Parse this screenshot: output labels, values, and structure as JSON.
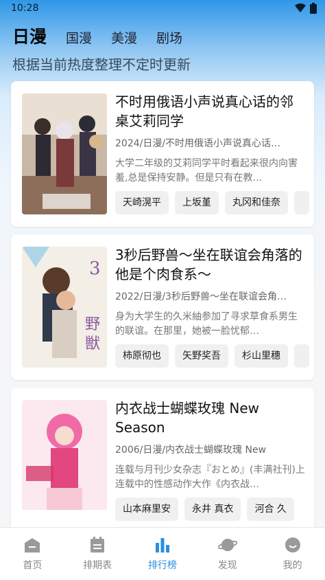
{
  "status": {
    "time": "10:28",
    "wifi_icon": "wifi-icon",
    "battery_icon": "battery-icon"
  },
  "tabs": [
    {
      "label": "日漫",
      "active": true
    },
    {
      "label": "国漫",
      "active": false
    },
    {
      "label": "美漫",
      "active": false
    },
    {
      "label": "剧场",
      "active": false
    }
  ],
  "subtitle": "根据当前热度整理不定时更新",
  "cards": [
    {
      "title": "不时用俄语小声说真心话的邻桌艾莉同学",
      "meta": "2024/日漫/不时用俄语小声说真心话…",
      "desc": "大学二年级的艾莉同学平时看起来很内向害羞,总是保持安静。但是只有在教…",
      "cast": [
        "天崎滉平",
        "上坂堇",
        "丸冈和佳奈",
        ""
      ]
    },
    {
      "title": "3秒后野兽～坐在联谊会角落的他是个肉食系～",
      "meta": "2022/日漫/3秒后野兽～坐在联谊会角…",
      "desc": "身为大学生的久米紬参加了寻求草食系男生的联谊。在那里，她被一脸忧郁…",
      "cast": [
        "柿原彻也",
        "矢野奖吾",
        "杉山里穗",
        ""
      ]
    },
    {
      "title": "内衣战士蝴蝶玫瑰  New Season",
      "meta": "2006/日漫/内衣战士蝴蝶玫瑰  New",
      "desc": "连载与月刊少女杂志『おとめ』(丰满社刊)上连载中的性感动作大作《内衣战…",
      "cast": [
        "山本麻里安",
        "永井   真衣",
        "河合   久"
      ]
    }
  ],
  "nav": [
    {
      "label": "首页",
      "icon": "home-icon",
      "active": false
    },
    {
      "label": "排期表",
      "icon": "calendar-icon",
      "active": false
    },
    {
      "label": "排行榜",
      "icon": "bar-chart-icon",
      "active": true
    },
    {
      "label": "发现",
      "icon": "planet-icon",
      "active": false
    },
    {
      "label": "我的",
      "icon": "smiley-icon",
      "active": false
    }
  ],
  "colors": {
    "accent": "#2b8fde",
    "inactive": "#888888"
  }
}
